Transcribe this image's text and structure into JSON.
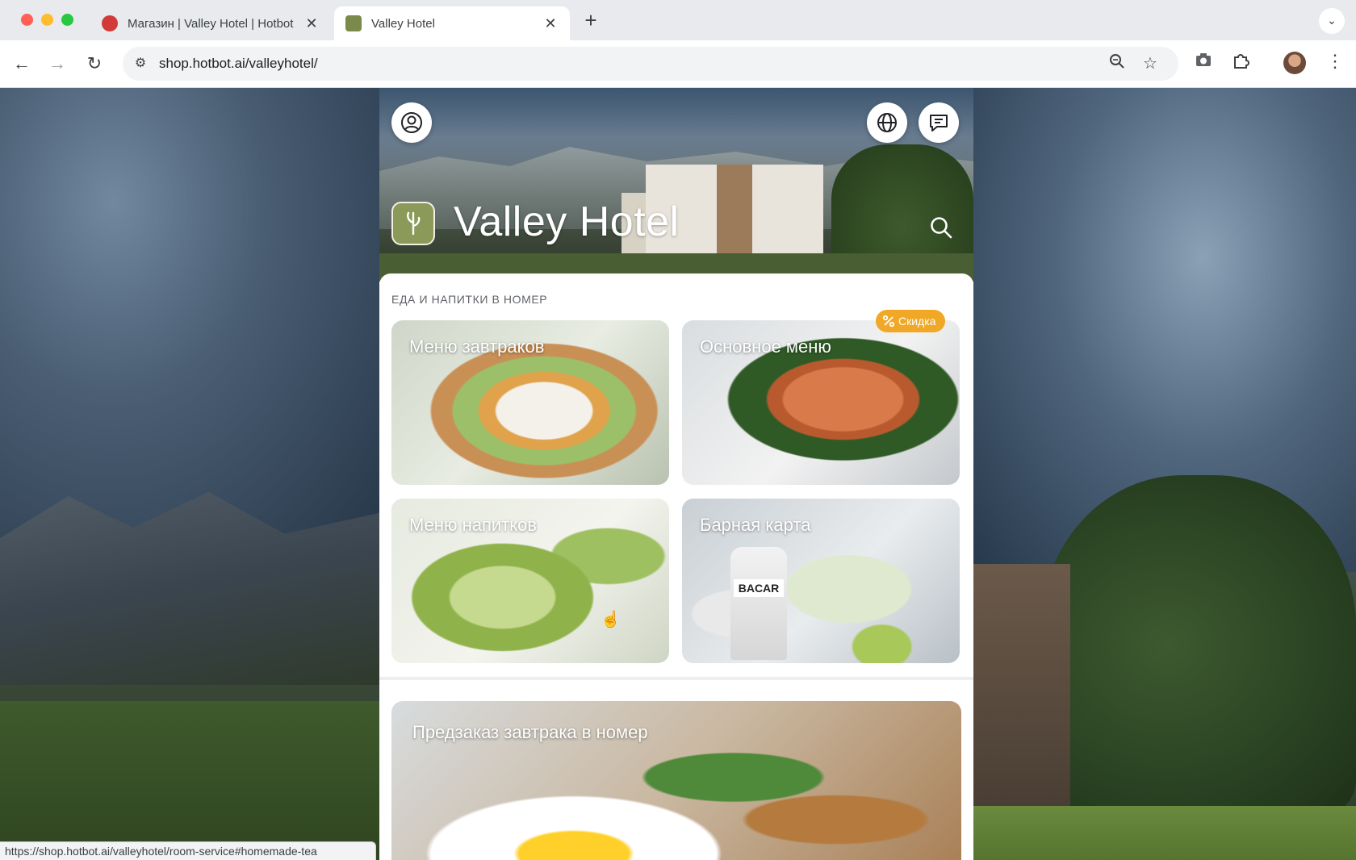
{
  "browser": {
    "tabs": [
      {
        "title": "Магазин | Valley Hotel | Hotbot",
        "active": false
      },
      {
        "title": "Valley Hotel",
        "active": true
      }
    ],
    "new_tab_label": "+",
    "url": "shop.hotbot.ai/valleyhotel/",
    "status_url": "https://shop.hotbot.ai/valleyhotel/room-service#homemade-tea"
  },
  "hotel": {
    "name": "Valley Hotel"
  },
  "room_service": {
    "section_title": "ЕДА И НАПИТКИ В НОМЕР",
    "categories": [
      {
        "label": "Меню завтраков"
      },
      {
        "label": "Основное меню",
        "badge": "Скидка"
      },
      {
        "label": "Меню напитков"
      },
      {
        "label": "Барная карта"
      }
    ],
    "bottle_text": "BACAR",
    "preorder": {
      "label": "Предзаказ завтрака в номер"
    }
  },
  "icons": {
    "user": "user-circle-icon",
    "language": "globe-icon",
    "chat": "chat-bubble-icon",
    "search": "search-icon",
    "discount": "percent-icon"
  },
  "colors": {
    "badge": "#f0a826",
    "logo_bg": "#8b9a58"
  }
}
